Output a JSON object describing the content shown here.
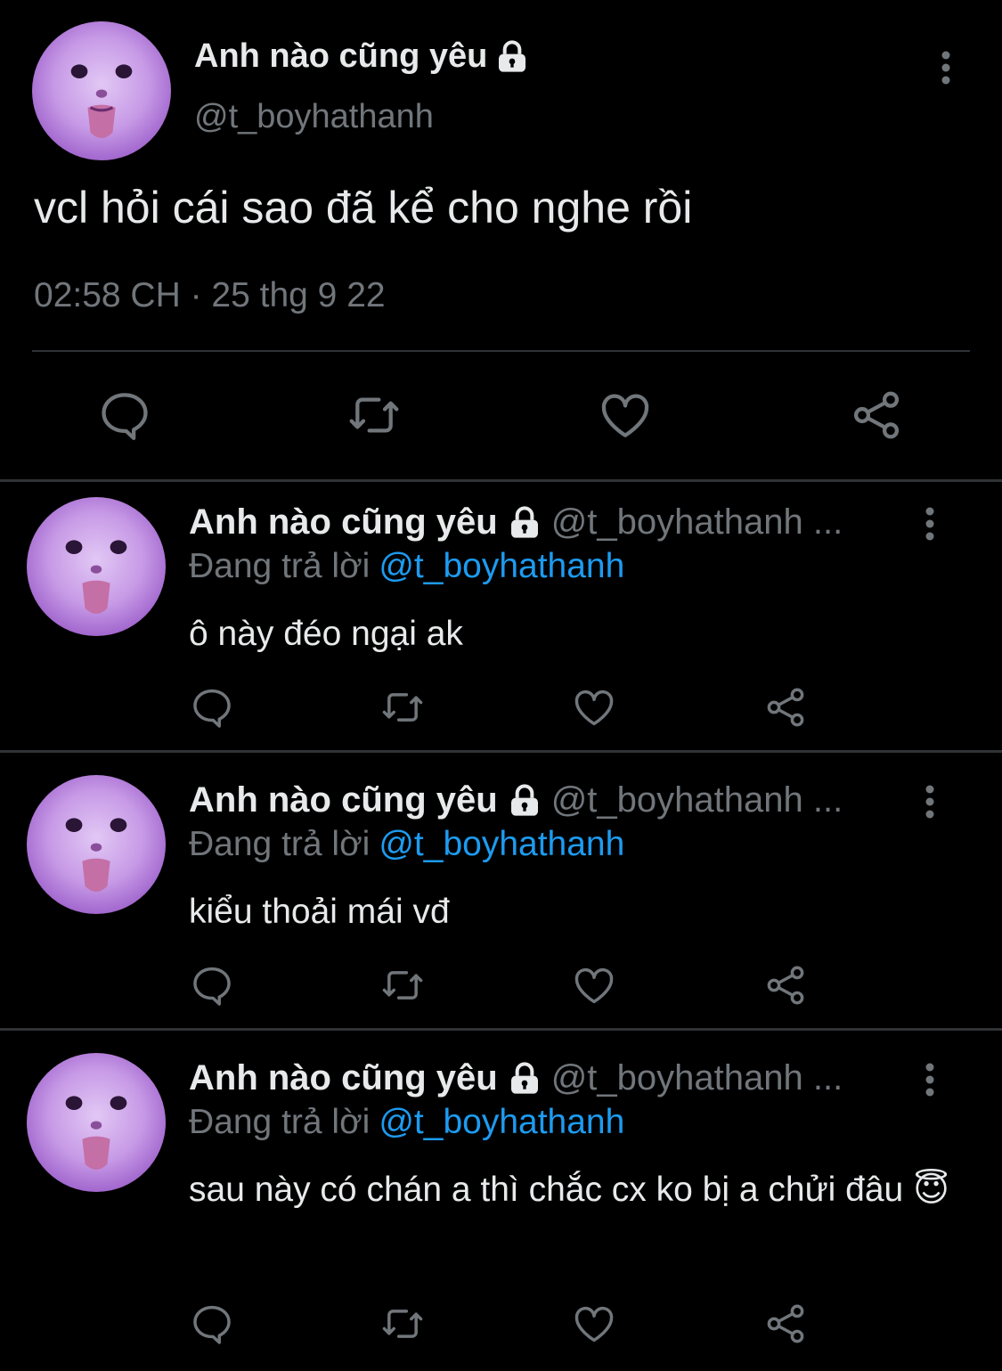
{
  "main_tweet": {
    "display_name": "Anh nào cũng yêu",
    "handle": "@t_boyhathanh",
    "text": "vcl hỏi cái sao đã kể cho nghe rồi",
    "timestamp": "02:58 CH · 25 thg 9 22"
  },
  "icons": {
    "reply": "reply-icon",
    "retweet": "retweet-icon",
    "like": "heart-icon",
    "share": "share-icon",
    "more": "more-vertical-icon",
    "lock": "lock-icon"
  },
  "colors": {
    "background": "#000000",
    "text": "#e7e9ea",
    "muted": "#71767b",
    "link": "#1d9bf0",
    "divider": "#2f3336"
  },
  "replies": [
    {
      "display_name": "Anh nào cũng yêu",
      "handle": "@t_boyhathanh ...",
      "replying_label": "Đang trả lời",
      "replying_to": "@t_boyhathanh",
      "text": "ô này đéo ngại ak"
    },
    {
      "display_name": "Anh nào cũng yêu",
      "handle": "@t_boyhathanh ...",
      "replying_label": "Đang trả lời",
      "replying_to": "@t_boyhathanh",
      "text": "kiểu thoải mái vđ"
    },
    {
      "display_name": "Anh nào cũng yêu",
      "handle": "@t_boyhathanh ...",
      "replying_label": "Đang trả lời",
      "replying_to": "@t_boyhathanh",
      "text": "sau này có chán a thì chắc cx ko bị a chửi đâu 😇"
    }
  ]
}
